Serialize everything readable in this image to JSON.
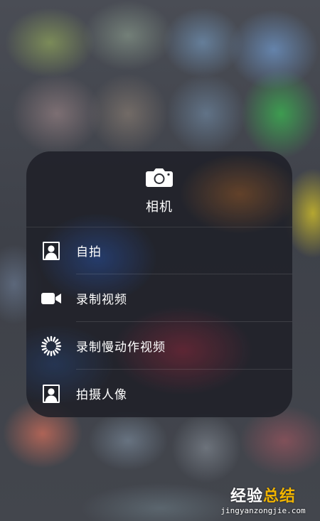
{
  "panel": {
    "title": "相机",
    "header_icon": "camera-icon"
  },
  "actions": [
    {
      "label": "自拍",
      "icon": "selfie-portrait-icon"
    },
    {
      "label": "录制视频",
      "icon": "video-camera-icon"
    },
    {
      "label": "录制慢动作视频",
      "icon": "slow-motion-icon"
    },
    {
      "label": "拍摄人像",
      "icon": "portrait-icon"
    }
  ],
  "watermark": {
    "part1": "经验",
    "part2": "总结",
    "url": "jingyanzongjie.com"
  }
}
